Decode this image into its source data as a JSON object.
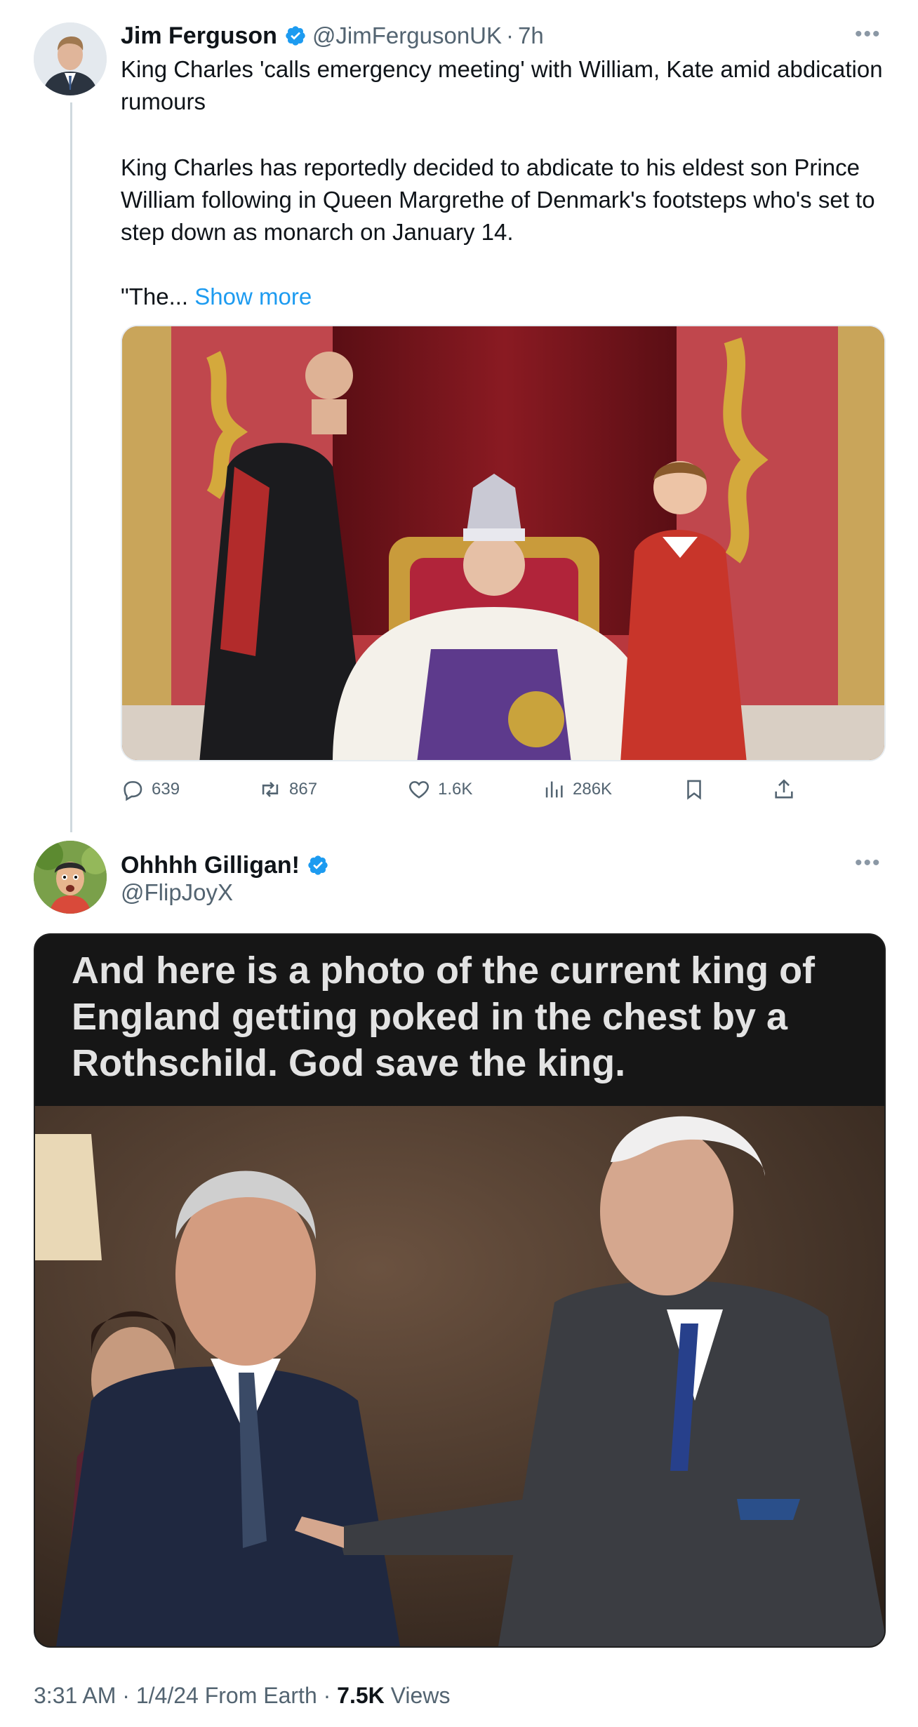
{
  "tweet1": {
    "display_name": "Jim Ferguson",
    "handle": "@JimFergusonUK",
    "separator": "·",
    "time": "7h",
    "para1": "King Charles 'calls emergency meeting' with William, Kate amid abdication rumours",
    "para2": "King Charles has reportedly decided to abdicate to his eldest son Prince William following in Queen Margrethe of Denmark's footsteps who's set to step down as monarch on January 14.",
    "para3_prefix": "\"The... ",
    "show_more": "Show more",
    "stats": {
      "replies": "639",
      "reposts": "867",
      "likes": "1.6K",
      "views": "286K"
    }
  },
  "tweet2": {
    "display_name": "Ohhhh Gilligan!",
    "handle": "@FlipJoyX",
    "image_caption": "And here is a photo of the current king of England getting poked in the chest by a Rothschild. God save the king.",
    "meta_time": "3:31 AM · 1/4/24 From Earth · ",
    "meta_views": "7.5K",
    "meta_views_label": " Views"
  },
  "icons": {
    "verified": "verified-badge-icon",
    "more": "more-dots-icon",
    "reply": "reply-icon",
    "repost": "repost-icon",
    "like": "like-icon",
    "views": "views-chart-icon",
    "bookmark": "bookmark-icon",
    "share": "share-icon"
  },
  "colors": {
    "accent": "#1d9bf0",
    "secondary_text": "#536471",
    "primary_text": "#0f1419"
  }
}
